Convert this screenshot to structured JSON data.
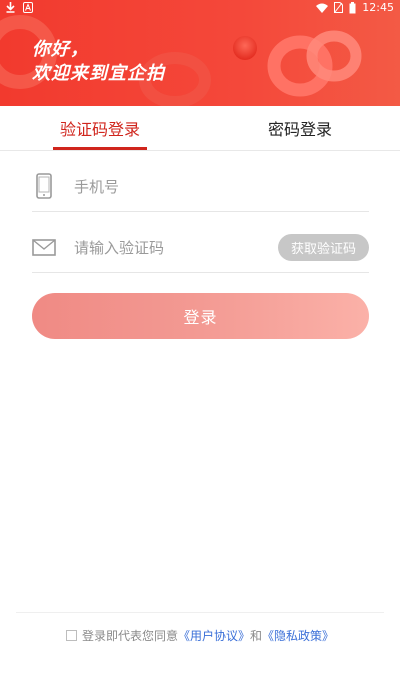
{
  "status_bar": {
    "time": "12:45",
    "left_icons": [
      "download-icon",
      "app-a-icon"
    ],
    "right_icons": [
      "wifi-icon",
      "no-sim-icon",
      "battery-icon"
    ]
  },
  "header": {
    "greeting_line1": "你好，",
    "greeting_line2": "欢迎来到宜企拍",
    "background_color": "#f23a2e"
  },
  "tabs": [
    {
      "label": "验证码登录",
      "active": true
    },
    {
      "label": "密码登录",
      "active": false
    }
  ],
  "form": {
    "phone": {
      "value": "",
      "placeholder": "手机号",
      "icon": "phone-icon"
    },
    "code": {
      "value": "",
      "placeholder": "请输入验证码",
      "icon": "mail-icon"
    },
    "get_code_label": "获取验证码",
    "login_label": "登录"
  },
  "agreement": {
    "prefix": "登录即代表您同意",
    "user_agreement": "《用户协议》",
    "and": "和",
    "privacy_policy": "《隐私政策》",
    "link_color": "#3a6fd8",
    "checked": false
  },
  "colors": {
    "accent": "#d0251c",
    "button_gradient_start": "#f08a84",
    "button_gradient_end": "#fbb1a8"
  }
}
